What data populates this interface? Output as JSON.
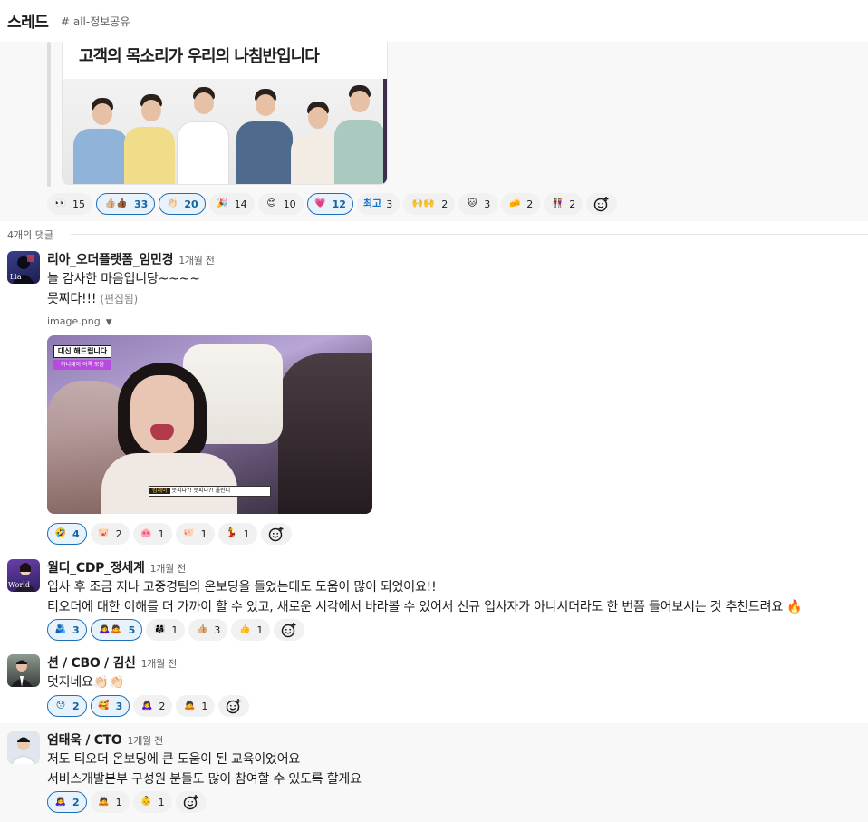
{
  "header": {
    "title": "스레드",
    "channel": "# all-정보공유"
  },
  "parent": {
    "article_headline": "고객의 목소리가 우리의 나침반입니다",
    "reactions": [
      {
        "emoji": "eyes",
        "glyph": "👀",
        "count": "15",
        "active": false
      },
      {
        "emoji": "thumbsup-multi",
        "glyph": "👍🏼👍🏾",
        "count": "33",
        "active": true
      },
      {
        "emoji": "clap",
        "glyph": "👏🏻",
        "count": "20",
        "active": true
      },
      {
        "emoji": "party-blob",
        "glyph": "🎉",
        "count": "14",
        "active": false
      },
      {
        "emoji": "blush-face",
        "glyph": "😊",
        "count": "10",
        "active": false
      },
      {
        "emoji": "pink-heart",
        "glyph": "💗",
        "count": "12",
        "active": true
      },
      {
        "emoji": "best-text",
        "glyph": "최고",
        "count": "3",
        "active": false
      },
      {
        "emoji": "raised-hands",
        "glyph": "🙌🙌",
        "count": "2",
        "active": false
      },
      {
        "emoji": "cat-face",
        "glyph": "🐱",
        "count": "3",
        "active": false
      },
      {
        "emoji": "cheese",
        "glyph": "🧀",
        "count": "2",
        "active": false
      },
      {
        "emoji": "two-people",
        "glyph": "👭",
        "count": "2",
        "active": false
      }
    ]
  },
  "divider": {
    "label": "4개의 댓글"
  },
  "messages": [
    {
      "author": "리아_오더플랫폼_임민경",
      "time": "1개월 전",
      "lines": [
        "늘 감사한 마음입니당~~~~",
        "믓찌다!!!"
      ],
      "edited": "(편집됨)",
      "file": {
        "name": "image.png",
        "badge_top": "대신 해드립니다",
        "badge_sub": "하니재이 어록 모음",
        "subtitle_tag": "킴제이",
        "subtitle_text": "뭇피다?! 뭇피다?! 울린니"
      },
      "reactions": [
        {
          "emoji": "rofl",
          "glyph": "🤣",
          "count": "4",
          "active": true
        },
        {
          "emoji": "pig-face",
          "glyph": "🐷",
          "count": "2",
          "active": false
        },
        {
          "emoji": "pig-blob",
          "glyph": "🐽",
          "count": "1",
          "active": false
        },
        {
          "emoji": "pig-square",
          "glyph": "🐖",
          "count": "1",
          "active": false
        },
        {
          "emoji": "dancer",
          "glyph": "💃",
          "count": "1",
          "active": false
        }
      ]
    },
    {
      "author": "월디_CDP_정세계",
      "time": "1개월 전",
      "lines": [
        "입사 후 조금 지나 고중경팀의 온보딩을 들었는데도 도움이 많이 되었어요!!",
        "티오더에 대한 이해를 더 가까이 할 수 있고, 새로운 시각에서 바라볼 수 있어서 신규 입사자가 아니시더라도 한 번쯤 들어보시는 것 추천드려요 🔥"
      ],
      "reactions": [
        {
          "emoji": "people-hugging",
          "glyph": "🫂",
          "count": "3",
          "active": true
        },
        {
          "emoji": "bowing-pair",
          "glyph": "🙇‍♀️🙇",
          "count": "5",
          "active": true
        },
        {
          "emoji": "people-group",
          "glyph": "👨‍👩‍👧",
          "count": "1",
          "active": false
        },
        {
          "emoji": "thumbsup-light",
          "glyph": "👍🏼",
          "count": "3",
          "active": false
        },
        {
          "emoji": "thumbsup",
          "glyph": "👍",
          "count": "1",
          "active": false
        }
      ]
    },
    {
      "author": "션 / CBO / 김신",
      "time": "1개월 전",
      "lines": [
        "멋지네요👏🏻👏🏻"
      ],
      "reactions": [
        {
          "emoji": "hushed-face",
          "glyph": "😯",
          "count": "2",
          "active": true
        },
        {
          "emoji": "star-struck",
          "glyph": "🥰",
          "count": "3",
          "active": true
        },
        {
          "emoji": "bowing-woman",
          "glyph": "🙇‍♀️",
          "count": "2",
          "active": false
        },
        {
          "emoji": "bowing-man",
          "glyph": "🙇",
          "count": "1",
          "active": false
        }
      ]
    },
    {
      "author": "엄태욱 / CTO",
      "time": "1개월 전",
      "lines": [
        "저도 티오더 온보딩에 큰 도움이 된 교육이었어요",
        "서비스개발본부 구성원 분들도 많이 참여할 수 있도록 할게요"
      ],
      "reactions": [
        {
          "emoji": "bowing-woman",
          "glyph": "🙇‍♀️",
          "count": "2",
          "active": true
        },
        {
          "emoji": "bowing-man",
          "glyph": "🙇",
          "count": "1",
          "active": false
        },
        {
          "emoji": "baby-face",
          "glyph": "👶",
          "count": "1",
          "active": false
        }
      ]
    }
  ],
  "colors": {
    "accent": "#1264a3",
    "active_bg": "#e8f2fb",
    "pill_bg": "#f1f1f1",
    "hover_bg": "#f8f8f8"
  },
  "avatars": [
    {
      "label": "Lia"
    },
    {
      "label": "World"
    }
  ]
}
